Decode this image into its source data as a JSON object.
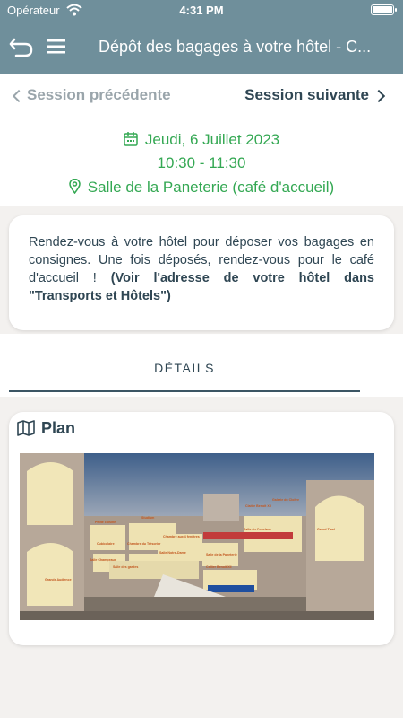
{
  "status_bar": {
    "carrier": "Opérateur",
    "time": "4:31 PM"
  },
  "header": {
    "title": "Dépôt des bagages à votre hôtel - C...",
    "icons": [
      "back-arrow-icon",
      "menu-icon"
    ],
    "background": "#6f8f9b"
  },
  "navigation": {
    "previous": "Session précédente",
    "next": "Session suivante"
  },
  "session": {
    "date": "Jeudi, 6 Juillet 2023",
    "time": "10:30 - 11:30",
    "location": "Salle de la Paneterie (café d'accueil)",
    "accent": "#34a853"
  },
  "description": {
    "text": "Rendez-vous à votre hôtel pour déposer vos bagages en consignes. Une fois déposés, rendez-vous pour le café d'accueil ! ",
    "emphasis": "(Voir l'adresse de votre hôtel dans \"Transports et Hôtels\")"
  },
  "tabs": {
    "details": "DÉTAILS"
  },
  "plan": {
    "title": "Plan",
    "labels": {
      "galerie": "Galerie du Cloître",
      "clairie": "Claitre Benoit XII",
      "salle_conclave": "Salle du Conclave",
      "grand_tinel": "Grand Tinel",
      "petite_cuisine": "Petite cuisine",
      "studium": "Studium",
      "cabinet": "Cubiculaire",
      "chambre_tresorier": "Chambre du Trésorier",
      "chambre_cerfs": "Chambre aux 4 fenêtres",
      "salle_paneterie": "Salle de la Paneterie",
      "salle_notre_dame": "Salle Notre-Dame",
      "cellier": "Cellier Benoit XII",
      "salle_gardes": "Salle des gardes",
      "grande_audience": "Grande Audience",
      "salle_chapelle": "Salle Champeaux"
    }
  }
}
